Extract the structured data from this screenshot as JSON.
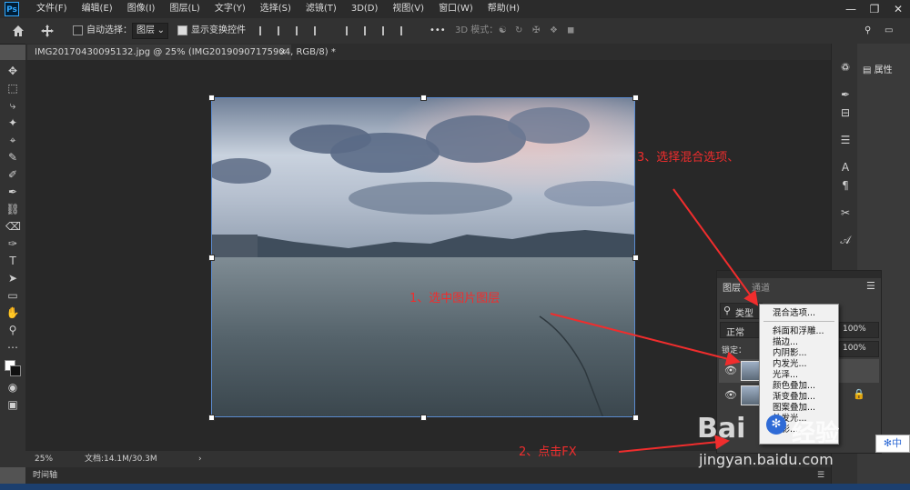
{
  "app": {
    "logo": "Ps"
  },
  "menu": [
    "文件(F)",
    "编辑(E)",
    "图像(I)",
    "图层(L)",
    "文字(Y)",
    "选择(S)",
    "滤镜(T)",
    "3D(D)",
    "视图(V)",
    "窗口(W)",
    "帮助(H)"
  ],
  "options": {
    "auto_select_label": "自动选择：",
    "auto_select_value": "图层",
    "show_transform_label": "显示变换控件",
    "more": "•••",
    "mode3d_label": "3D 模式："
  },
  "document": {
    "tab_title": "IMG20170430095132.jpg @ 25% (IMG20190907175904, RGB/8) *",
    "tab_close": "×"
  },
  "status": {
    "zoom": "25%",
    "doc_info": "文档:14.1M/30.3M",
    "arrow": "›"
  },
  "timeline": {
    "label": "时间轴"
  },
  "right_dock": {
    "properties_label": "属性"
  },
  "layers_panel": {
    "tab_layers": "图层",
    "tab_channels": "通道",
    "search_kind": "类型",
    "blend_mode": "正常",
    "opacity": "100%",
    "lock_label": "锁定：",
    "fill": "100%"
  },
  "context_menu": [
    "混合选项...",
    "斜面和浮雕...",
    "描边...",
    "内阴影...",
    "内发光...",
    "光泽...",
    "颜色叠加...",
    "渐变叠加...",
    "图案叠加...",
    "外发光...",
    "投影..."
  ],
  "annotations": {
    "step1": "1、选中图片图层",
    "step2": "2、点击FX",
    "step3": "3、选择混合选项、"
  },
  "watermark": {
    "brand": "Bai",
    "brand2": "经验",
    "url": "jingyan.baidu.com"
  },
  "ime": {
    "label": "中"
  },
  "colors": {
    "annotation": "#f02d2d",
    "ps_blue": "#31a8ff"
  }
}
